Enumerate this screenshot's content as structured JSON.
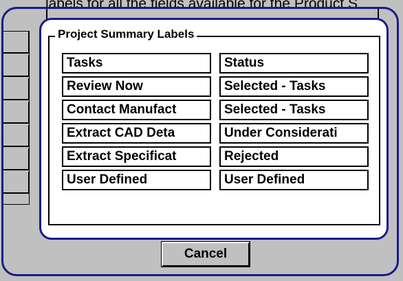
{
  "header_text": "labels for all the fields available for the Product S",
  "group_title": "Project Summary Labels",
  "left_labels": [
    "Tasks",
    "Review Now",
    "Contact Manufact",
    "Extract CAD Deta",
    "Extract Specificat",
    "User Defined"
  ],
  "right_labels": [
    "Status",
    "Selected - Tasks",
    "Selected - Tasks",
    "Under Considerati",
    "Rejected",
    "User Defined"
  ],
  "cancel_label": "Cancel",
  "colors": {
    "dialog_border": "#1a1a8c",
    "background": "#c0c0c0",
    "panel": "#ffffff"
  }
}
